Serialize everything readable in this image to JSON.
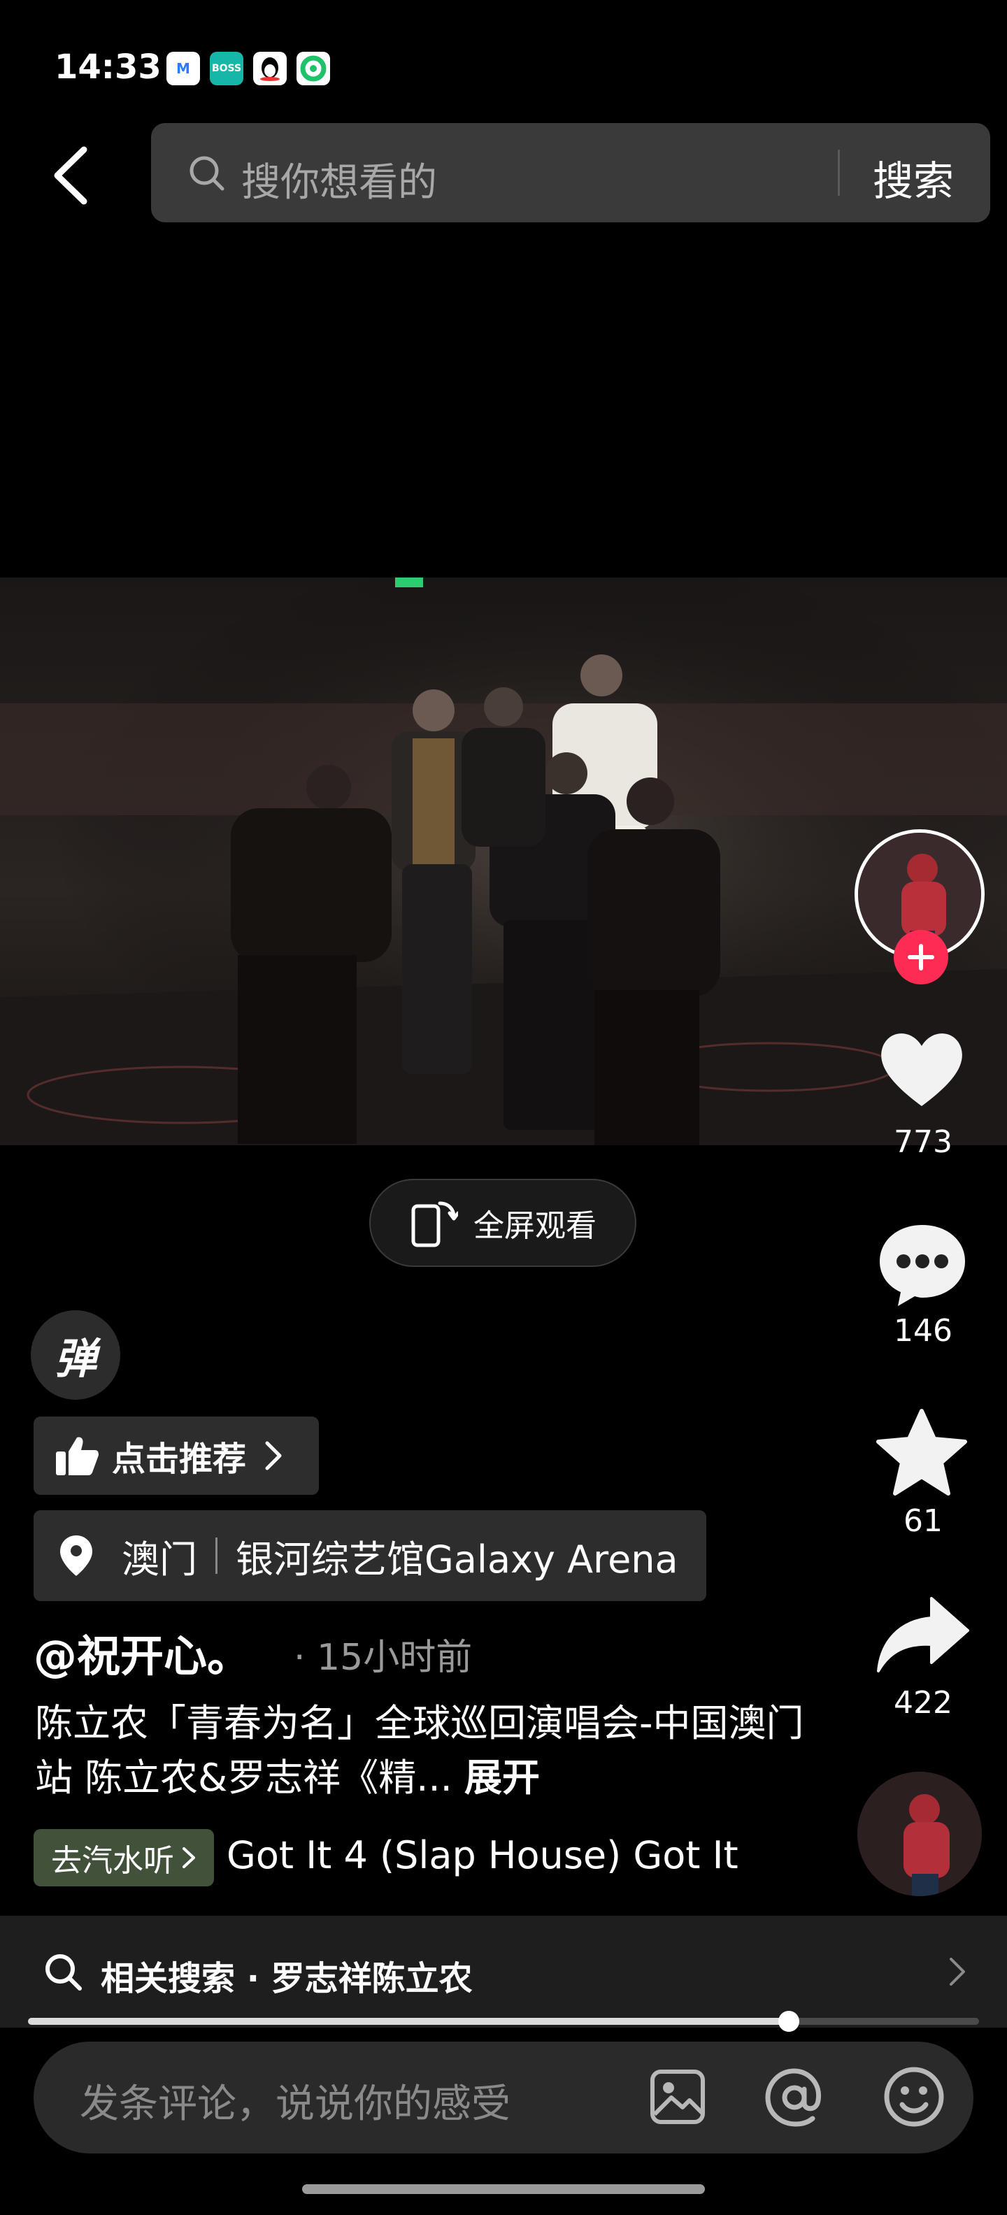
{
  "status_bar": {
    "time": "14:33",
    "app_icons": [
      {
        "name": "meituan-icon",
        "text": "M",
        "color": "#2a7cff"
      },
      {
        "name": "boss-zhipin-icon",
        "text": "BOSS",
        "color": "#16b6a8"
      },
      {
        "name": "qq-icon",
        "text": "",
        "color": "#ffffff"
      },
      {
        "name": "app-green-icon",
        "text": "",
        "color": "#1fc26b"
      }
    ]
  },
  "header": {
    "search_placeholder": "搜你想看的",
    "search_button": "搜索"
  },
  "video": {
    "fullscreen_label": "全屏观看"
  },
  "actions": {
    "likes": "773",
    "comments": "146",
    "favorites": "61",
    "shares": "422"
  },
  "danmu_label": "弹",
  "recommend": {
    "label": "点击推荐"
  },
  "location": {
    "city": "澳门",
    "venue": "银河综艺馆Galaxy Arena"
  },
  "post": {
    "author": "@祝开心。",
    "time_ago": "· 15小时前",
    "description": "陈立农「青春为名」全球巡回演唱会-中国澳门站 陈立农&罗志祥《精...",
    "expand_label": "展开"
  },
  "music": {
    "tag_label": "去汽水听",
    "title": "Got It 4 (Slap House)    Got It"
  },
  "related_search": {
    "label": "相关搜索 · 罗志祥陈立农"
  },
  "playback": {
    "progress": 0.8
  },
  "comment_bar": {
    "placeholder": "发条评论，说说你的感受"
  },
  "colors": {
    "accent": "#fe2c55",
    "background": "#000000",
    "surface": "#2d2d2d"
  }
}
